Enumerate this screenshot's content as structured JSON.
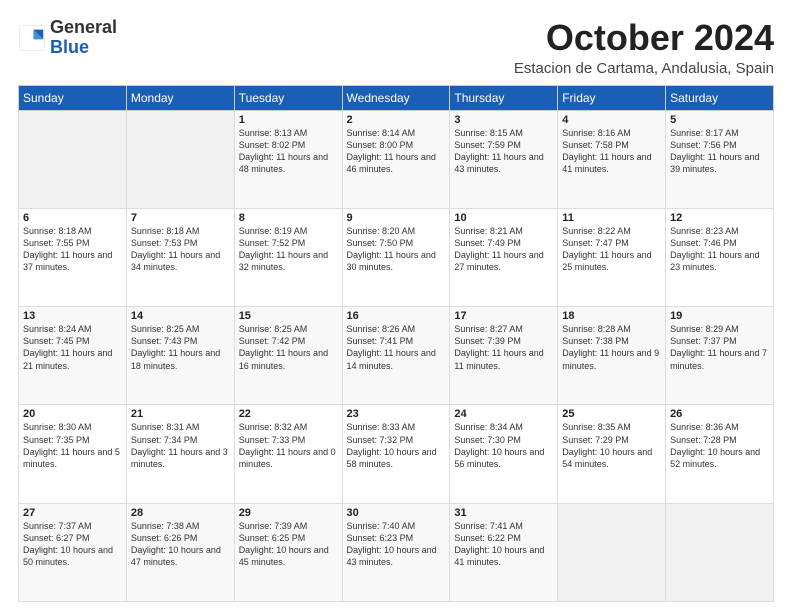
{
  "logo": {
    "general": "General",
    "blue": "Blue"
  },
  "header": {
    "month": "October 2024",
    "location": "Estacion de Cartama, Andalusia, Spain"
  },
  "days_of_week": [
    "Sunday",
    "Monday",
    "Tuesday",
    "Wednesday",
    "Thursday",
    "Friday",
    "Saturday"
  ],
  "weeks": [
    [
      {
        "day": "",
        "content": ""
      },
      {
        "day": "",
        "content": ""
      },
      {
        "day": "1",
        "content": "Sunrise: 8:13 AM\nSunset: 8:02 PM\nDaylight: 11 hours and 48 minutes."
      },
      {
        "day": "2",
        "content": "Sunrise: 8:14 AM\nSunset: 8:00 PM\nDaylight: 11 hours and 46 minutes."
      },
      {
        "day": "3",
        "content": "Sunrise: 8:15 AM\nSunset: 7:59 PM\nDaylight: 11 hours and 43 minutes."
      },
      {
        "day": "4",
        "content": "Sunrise: 8:16 AM\nSunset: 7:58 PM\nDaylight: 11 hours and 41 minutes."
      },
      {
        "day": "5",
        "content": "Sunrise: 8:17 AM\nSunset: 7:56 PM\nDaylight: 11 hours and 39 minutes."
      }
    ],
    [
      {
        "day": "6",
        "content": "Sunrise: 8:18 AM\nSunset: 7:55 PM\nDaylight: 11 hours and 37 minutes."
      },
      {
        "day": "7",
        "content": "Sunrise: 8:18 AM\nSunset: 7:53 PM\nDaylight: 11 hours and 34 minutes."
      },
      {
        "day": "8",
        "content": "Sunrise: 8:19 AM\nSunset: 7:52 PM\nDaylight: 11 hours and 32 minutes."
      },
      {
        "day": "9",
        "content": "Sunrise: 8:20 AM\nSunset: 7:50 PM\nDaylight: 11 hours and 30 minutes."
      },
      {
        "day": "10",
        "content": "Sunrise: 8:21 AM\nSunset: 7:49 PM\nDaylight: 11 hours and 27 minutes."
      },
      {
        "day": "11",
        "content": "Sunrise: 8:22 AM\nSunset: 7:47 PM\nDaylight: 11 hours and 25 minutes."
      },
      {
        "day": "12",
        "content": "Sunrise: 8:23 AM\nSunset: 7:46 PM\nDaylight: 11 hours and 23 minutes."
      }
    ],
    [
      {
        "day": "13",
        "content": "Sunrise: 8:24 AM\nSunset: 7:45 PM\nDaylight: 11 hours and 21 minutes."
      },
      {
        "day": "14",
        "content": "Sunrise: 8:25 AM\nSunset: 7:43 PM\nDaylight: 11 hours and 18 minutes."
      },
      {
        "day": "15",
        "content": "Sunrise: 8:25 AM\nSunset: 7:42 PM\nDaylight: 11 hours and 16 minutes."
      },
      {
        "day": "16",
        "content": "Sunrise: 8:26 AM\nSunset: 7:41 PM\nDaylight: 11 hours and 14 minutes."
      },
      {
        "day": "17",
        "content": "Sunrise: 8:27 AM\nSunset: 7:39 PM\nDaylight: 11 hours and 11 minutes."
      },
      {
        "day": "18",
        "content": "Sunrise: 8:28 AM\nSunset: 7:38 PM\nDaylight: 11 hours and 9 minutes."
      },
      {
        "day": "19",
        "content": "Sunrise: 8:29 AM\nSunset: 7:37 PM\nDaylight: 11 hours and 7 minutes."
      }
    ],
    [
      {
        "day": "20",
        "content": "Sunrise: 8:30 AM\nSunset: 7:35 PM\nDaylight: 11 hours and 5 minutes."
      },
      {
        "day": "21",
        "content": "Sunrise: 8:31 AM\nSunset: 7:34 PM\nDaylight: 11 hours and 3 minutes."
      },
      {
        "day": "22",
        "content": "Sunrise: 8:32 AM\nSunset: 7:33 PM\nDaylight: 11 hours and 0 minutes."
      },
      {
        "day": "23",
        "content": "Sunrise: 8:33 AM\nSunset: 7:32 PM\nDaylight: 10 hours and 58 minutes."
      },
      {
        "day": "24",
        "content": "Sunrise: 8:34 AM\nSunset: 7:30 PM\nDaylight: 10 hours and 56 minutes."
      },
      {
        "day": "25",
        "content": "Sunrise: 8:35 AM\nSunset: 7:29 PM\nDaylight: 10 hours and 54 minutes."
      },
      {
        "day": "26",
        "content": "Sunrise: 8:36 AM\nSunset: 7:28 PM\nDaylight: 10 hours and 52 minutes."
      }
    ],
    [
      {
        "day": "27",
        "content": "Sunrise: 7:37 AM\nSunset: 6:27 PM\nDaylight: 10 hours and 50 minutes."
      },
      {
        "day": "28",
        "content": "Sunrise: 7:38 AM\nSunset: 6:26 PM\nDaylight: 10 hours and 47 minutes."
      },
      {
        "day": "29",
        "content": "Sunrise: 7:39 AM\nSunset: 6:25 PM\nDaylight: 10 hours and 45 minutes."
      },
      {
        "day": "30",
        "content": "Sunrise: 7:40 AM\nSunset: 6:23 PM\nDaylight: 10 hours and 43 minutes."
      },
      {
        "day": "31",
        "content": "Sunrise: 7:41 AM\nSunset: 6:22 PM\nDaylight: 10 hours and 41 minutes."
      },
      {
        "day": "",
        "content": ""
      },
      {
        "day": "",
        "content": ""
      }
    ]
  ]
}
